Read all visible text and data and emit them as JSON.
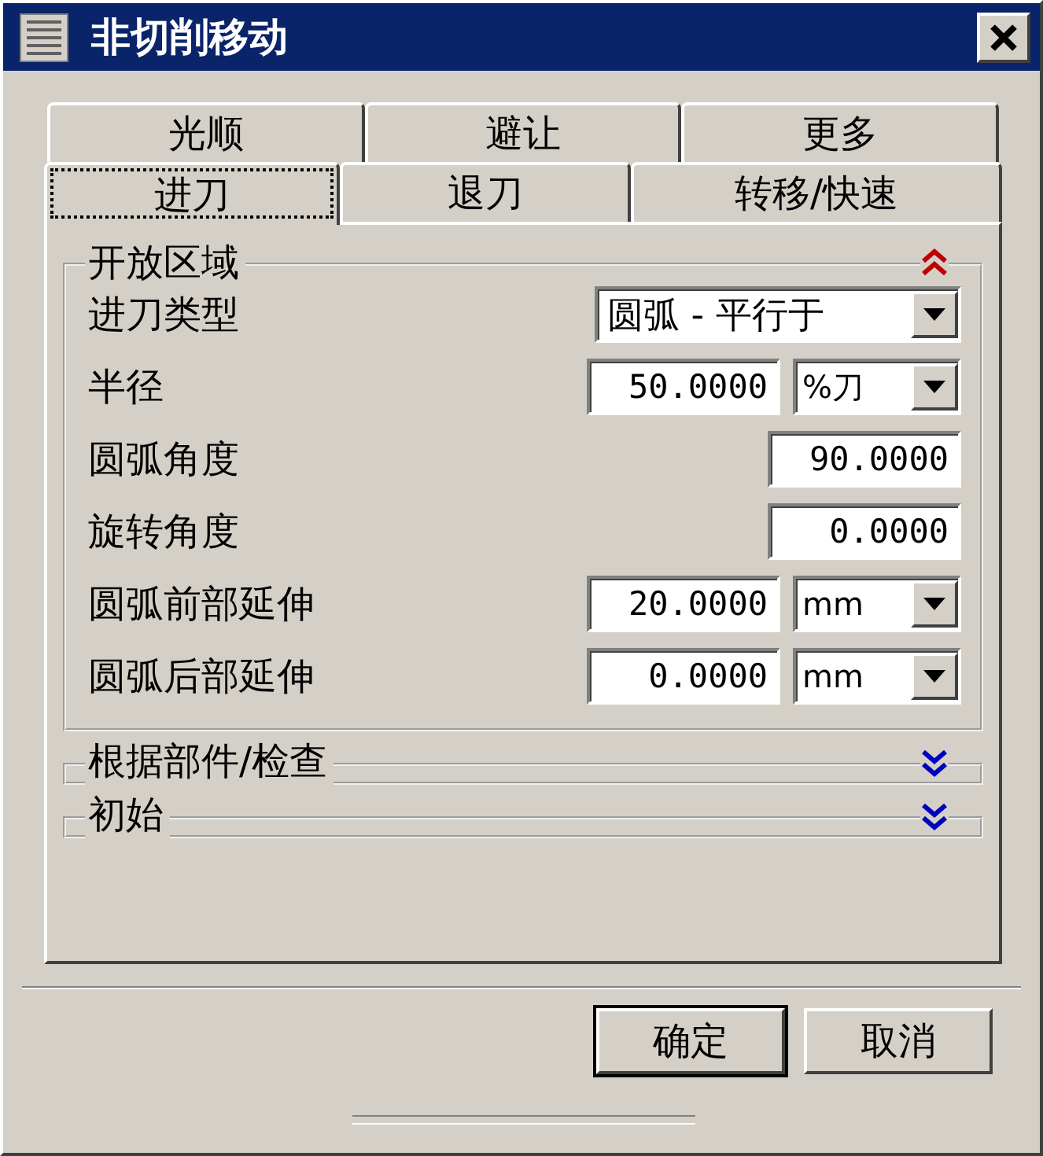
{
  "window": {
    "title": "非切削移动"
  },
  "tab_rows": [
    [
      {
        "label": "光顺",
        "selected": false
      },
      {
        "label": "避让",
        "selected": false
      },
      {
        "label": "更多",
        "selected": false
      }
    ],
    [
      {
        "label": "进刀",
        "selected": true
      },
      {
        "label": "退刀",
        "selected": false
      },
      {
        "label": "转移/快速",
        "selected": false
      }
    ]
  ],
  "sections": [
    {
      "title": "开放区域",
      "expanded": true,
      "fields": [
        {
          "kind": "dropdown",
          "label": "进刀类型",
          "value": "圆弧 - 平行于"
        },
        {
          "kind": "number_unit",
          "label": "半径",
          "value": "50.0000",
          "unit": "%刀"
        },
        {
          "kind": "number",
          "label": "圆弧角度",
          "value": "90.0000"
        },
        {
          "kind": "number",
          "label": "旋转角度",
          "value": "0.0000"
        },
        {
          "kind": "number_unit",
          "label": "圆弧前部延伸",
          "value": "20.0000",
          "unit": "mm"
        },
        {
          "kind": "number_unit",
          "label": "圆弧后部延伸",
          "value": "0.0000",
          "unit": "mm"
        }
      ]
    },
    {
      "title": "根据部件/检查",
      "expanded": false
    },
    {
      "title": "初始",
      "expanded": false
    }
  ],
  "buttons": [
    {
      "label": "确定",
      "default": true
    },
    {
      "label": "取消",
      "default": false
    }
  ]
}
